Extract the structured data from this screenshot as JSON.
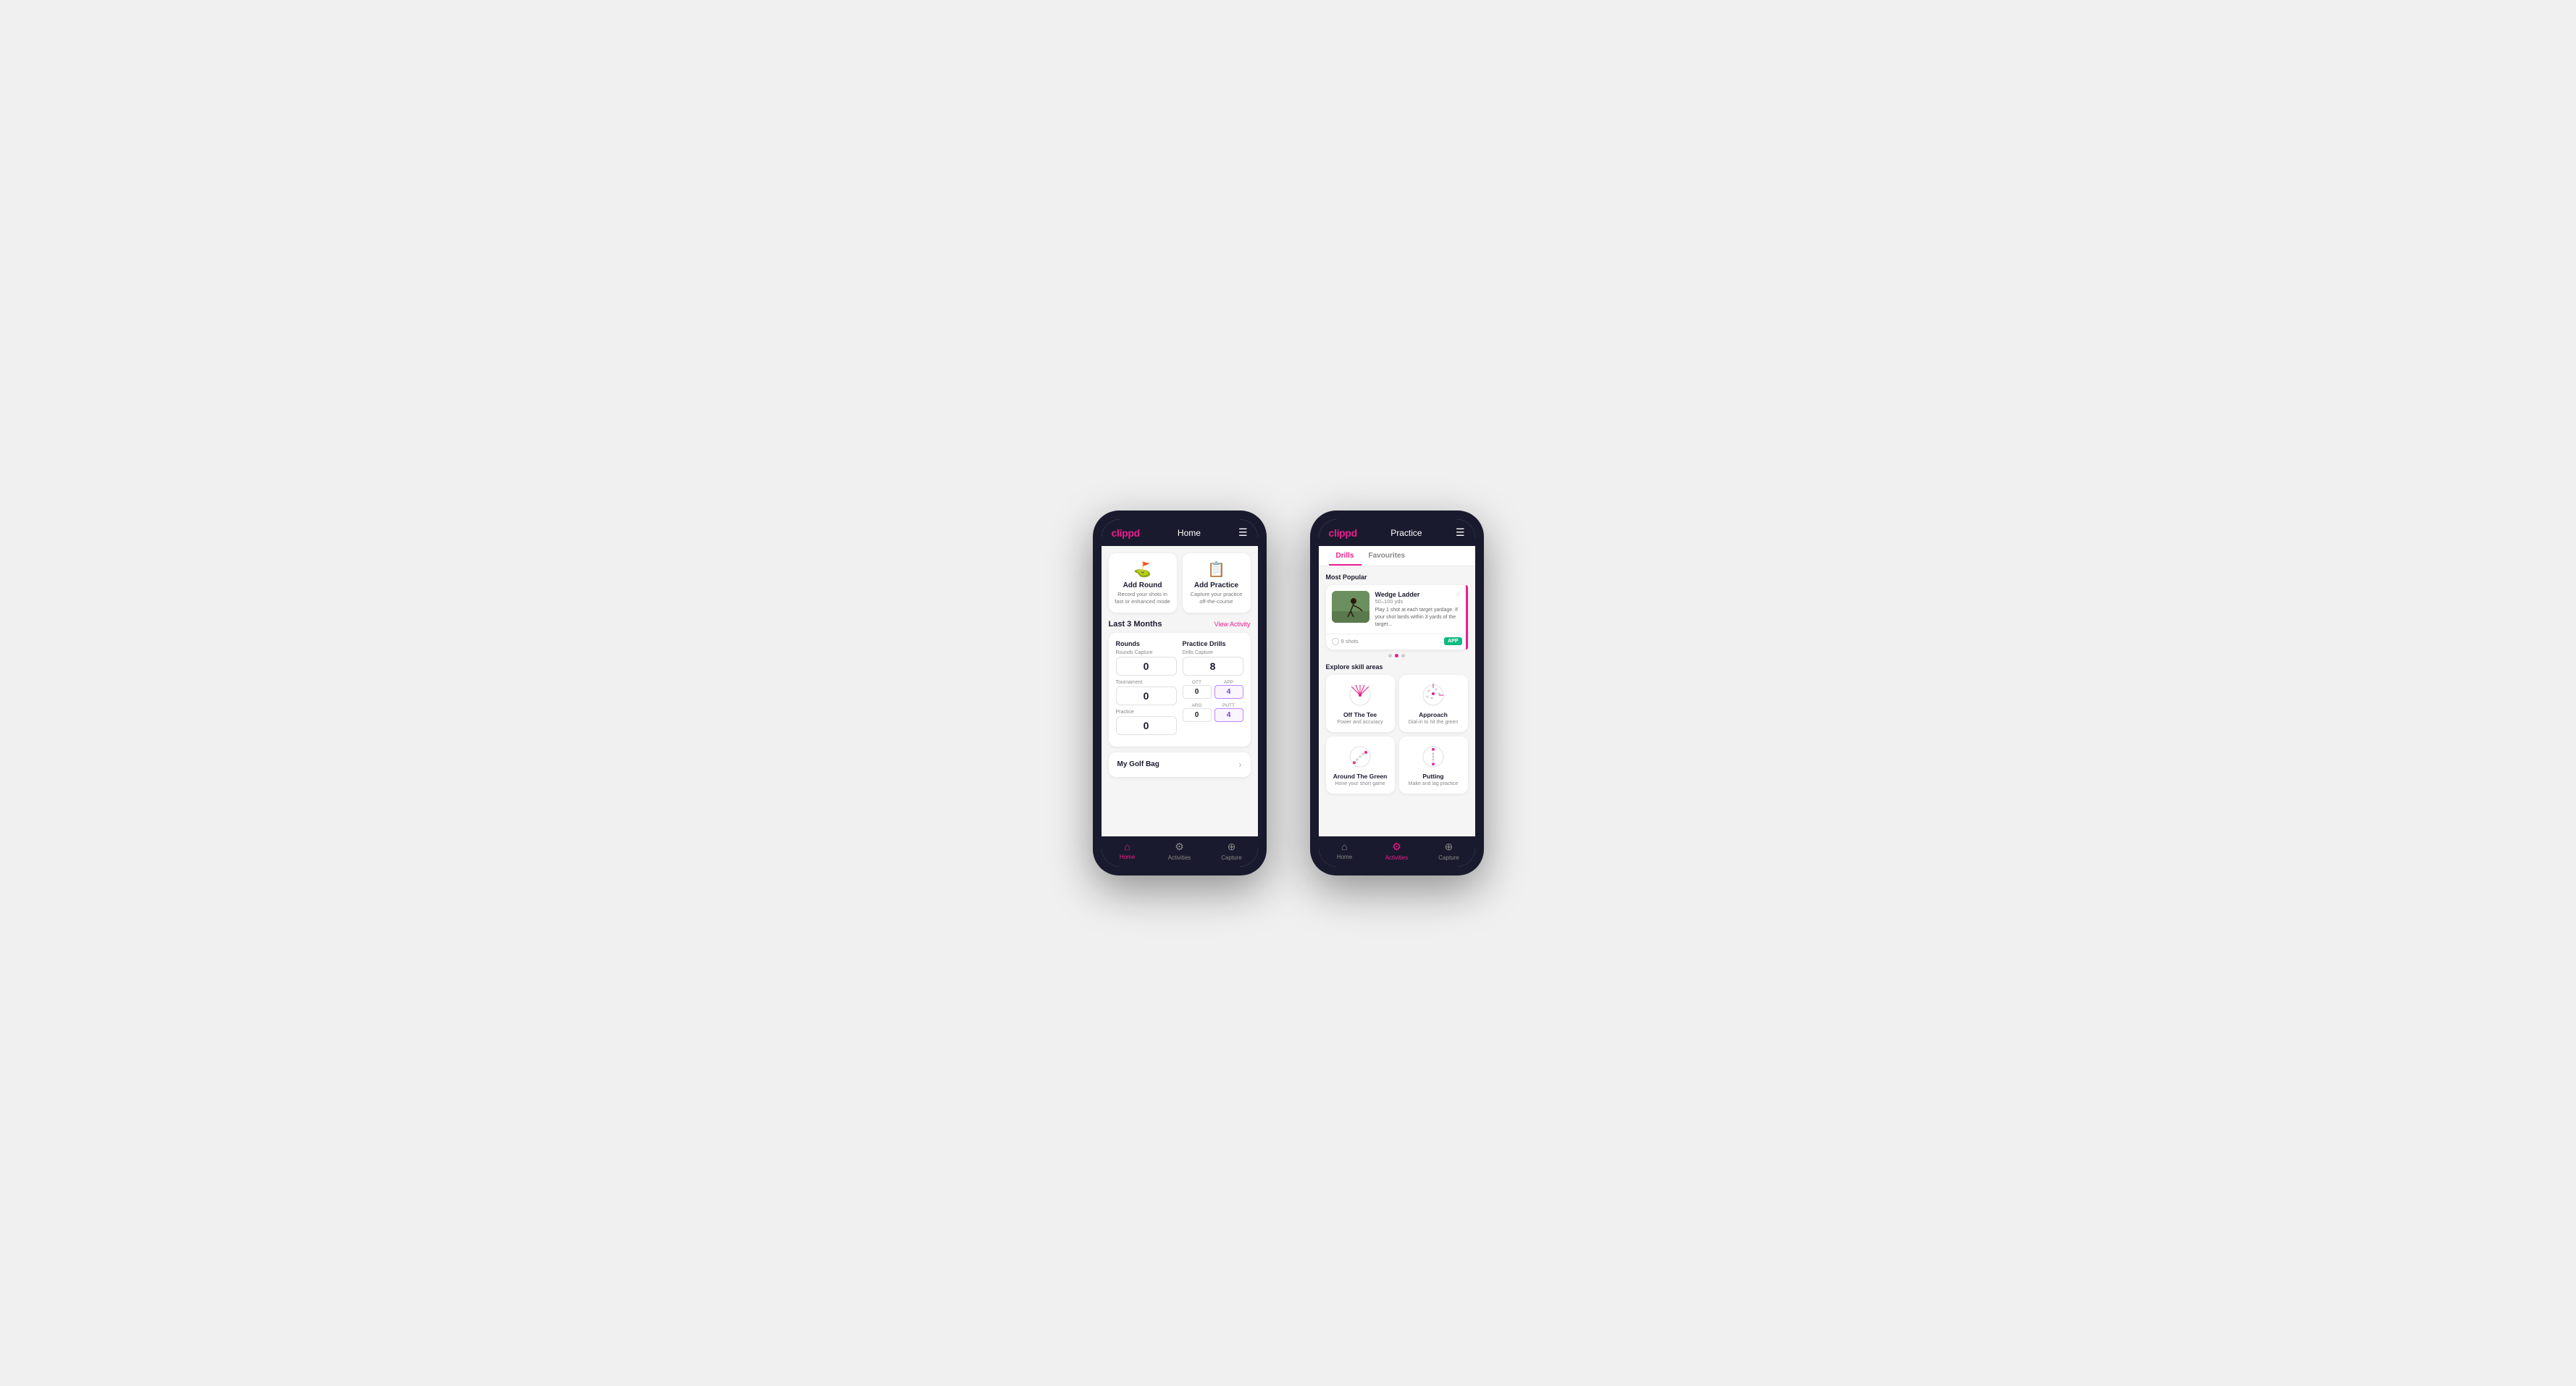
{
  "phone1": {
    "logo": "clippd",
    "title": "Home",
    "action_cards": [
      {
        "id": "add-round",
        "icon": "⛳",
        "title": "Add Round",
        "desc": "Record your shots in fast or enhanced mode"
      },
      {
        "id": "add-practice",
        "icon": "📋",
        "title": "Add Practice",
        "desc": "Capture your practice off-the-course"
      }
    ],
    "stats_section": {
      "title": "Last 3 Months",
      "link": "View Activity",
      "rounds": {
        "title": "Rounds",
        "capture_label": "Rounds Capture",
        "capture_value": "0",
        "sub_labels": [
          "Tournament",
          "Practice"
        ],
        "sub_values": [
          "0",
          "0"
        ]
      },
      "drills": {
        "title": "Practice Drills",
        "capture_label": "Drills Capture",
        "capture_value": "8",
        "sub_labels": [
          "OTT",
          "APP",
          "ARG",
          "PUTT"
        ],
        "sub_values": [
          "0",
          "4",
          "0",
          "4"
        ],
        "highlight_indices": [
          1,
          3
        ]
      }
    },
    "golf_bag_label": "My Golf Bag",
    "nav": [
      {
        "label": "Home",
        "active": true,
        "icon": "⌂"
      },
      {
        "label": "Activities",
        "active": false,
        "icon": "⚙"
      },
      {
        "label": "Capture",
        "active": false,
        "icon": "⊕"
      }
    ]
  },
  "phone2": {
    "logo": "clippd",
    "title": "Practice",
    "tabs": [
      {
        "label": "Drills",
        "active": true
      },
      {
        "label": "Favourites",
        "active": false
      }
    ],
    "most_popular_label": "Most Popular",
    "drill": {
      "title": "Wedge Ladder",
      "subtitle": "50–100 yds",
      "desc": "Play 1 shot at each target yardage. If your shot lands within 3 yards of the target...",
      "shots": "9 shots",
      "badge": "APP"
    },
    "dots": [
      false,
      true,
      false
    ],
    "explore_label": "Explore skill areas",
    "skill_areas": [
      {
        "id": "off-the-tee",
        "name": "Off The Tee",
        "desc": "Power and accuracy"
      },
      {
        "id": "approach",
        "name": "Approach",
        "desc": "Dial-in to hit the green"
      },
      {
        "id": "around-the-green",
        "name": "Around The Green",
        "desc": "Hone your short game"
      },
      {
        "id": "putting",
        "name": "Putting",
        "desc": "Make and lag practice"
      }
    ],
    "nav": [
      {
        "label": "Home",
        "active": false,
        "icon": "⌂"
      },
      {
        "label": "Activities",
        "active": true,
        "icon": "⚙"
      },
      {
        "label": "Capture",
        "active": false,
        "icon": "⊕"
      }
    ]
  }
}
